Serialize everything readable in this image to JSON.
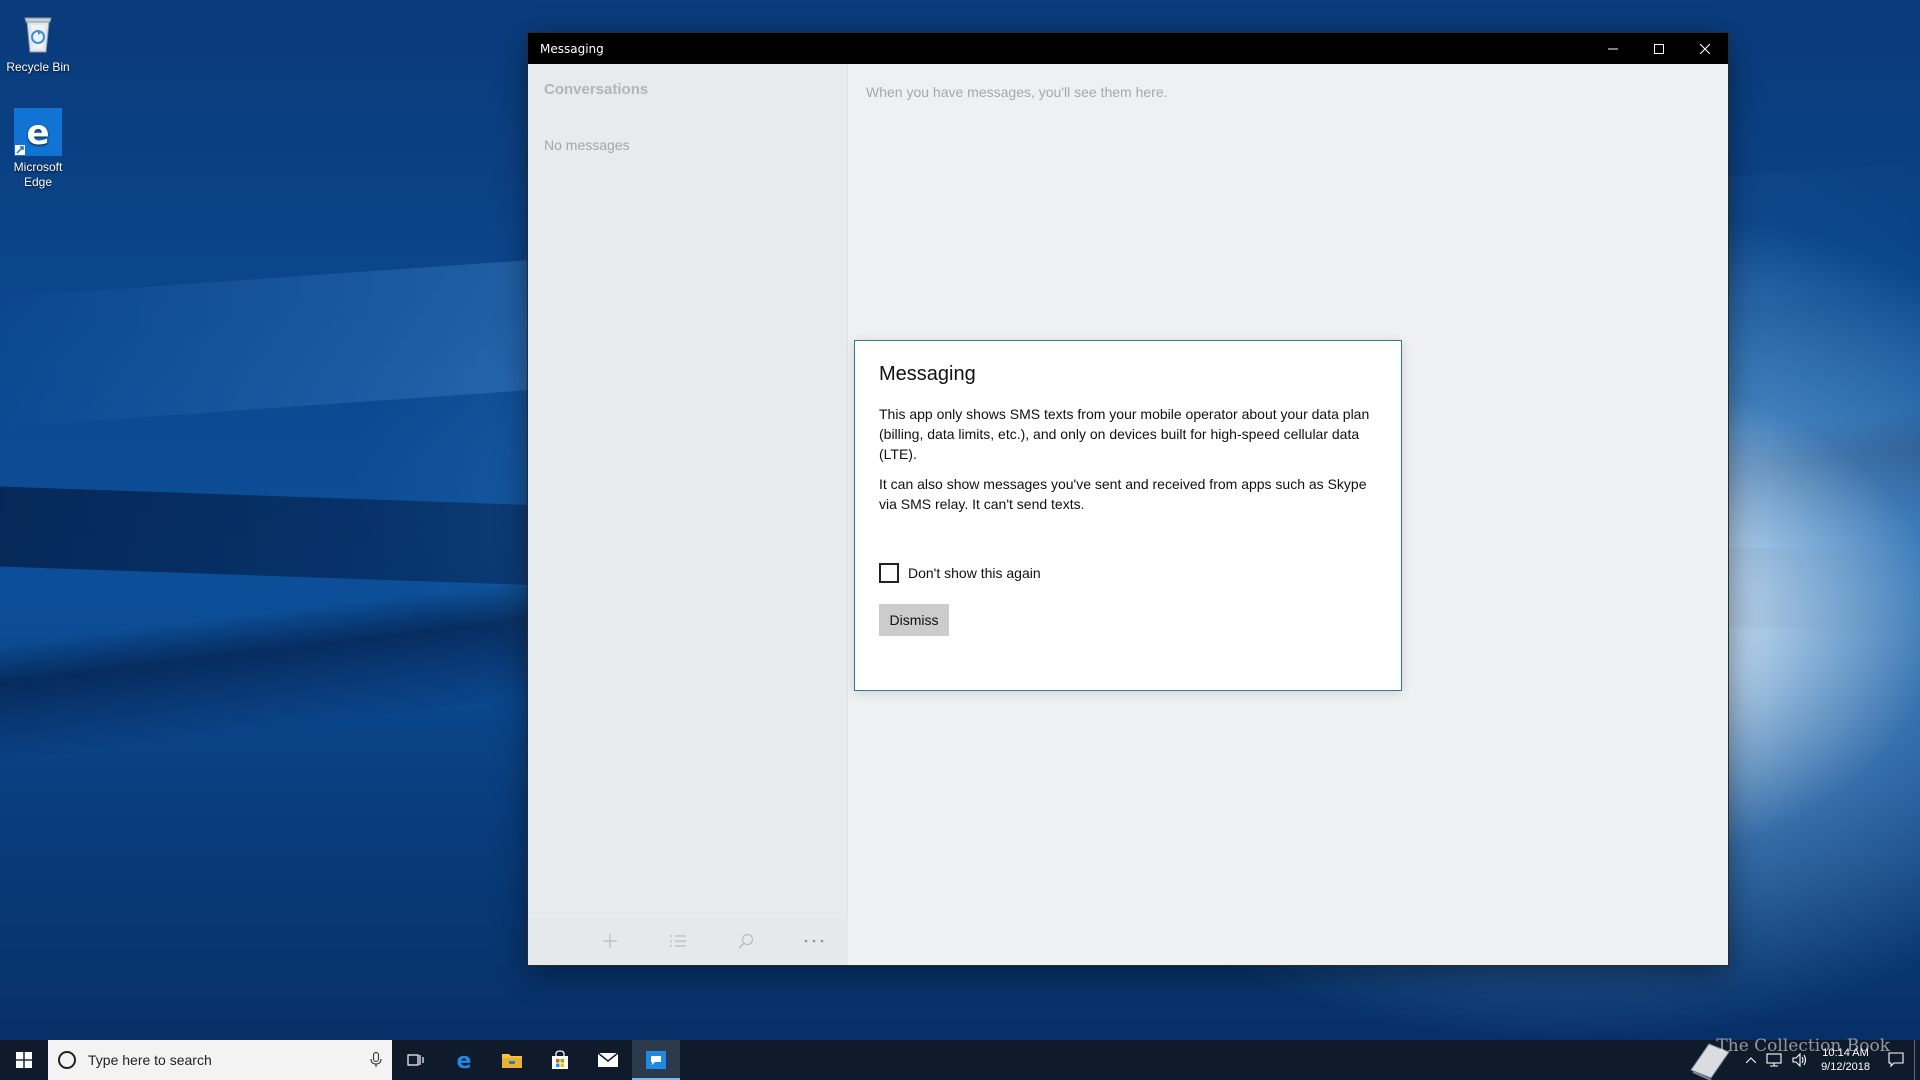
{
  "desktop": {
    "icons": [
      {
        "label": "Recycle Bin",
        "icon": "recycle-bin-icon"
      },
      {
        "label": "Microsoft Edge",
        "icon": "edge-icon"
      }
    ]
  },
  "window": {
    "title": "Messaging",
    "controls": {
      "minimize": "minimize-icon",
      "maximize": "maximize-icon",
      "close": "close-icon"
    }
  },
  "left_pane": {
    "title": "Conversations",
    "empty_text": "No messages",
    "bottom_bar": [
      "add-icon",
      "select-icon",
      "search-icon",
      "more-icon"
    ]
  },
  "right_pane": {
    "empty_hint": "When you have messages, you'll see them here."
  },
  "dialog": {
    "title": "Messaging",
    "paragraph1": "This app only shows SMS texts from your mobile operator about your data plan (billing, data limits, etc.), and only on devices built for high-speed cellular data (LTE).",
    "paragraph2": "It can also show messages you've sent and received from apps such as Skype via SMS relay. It can't send texts.",
    "checkbox_label": "Don't show this again",
    "checkbox_checked": false,
    "dismiss_label": "Dismiss"
  },
  "taskbar": {
    "search_placeholder": "Type here to search",
    "pinned": [
      "task-view-icon",
      "edge-icon",
      "file-explorer-icon",
      "store-icon",
      "mail-icon",
      "messaging-icon"
    ],
    "active": "messaging-icon",
    "clock_time": "10:14 AM",
    "clock_date": "9/12/2018",
    "watermark": "The Collection Book"
  },
  "colors": {
    "dialog_border": "#2b7aa0",
    "taskbar": "#0f1b2b",
    "active_indicator": "#76b9ed"
  }
}
